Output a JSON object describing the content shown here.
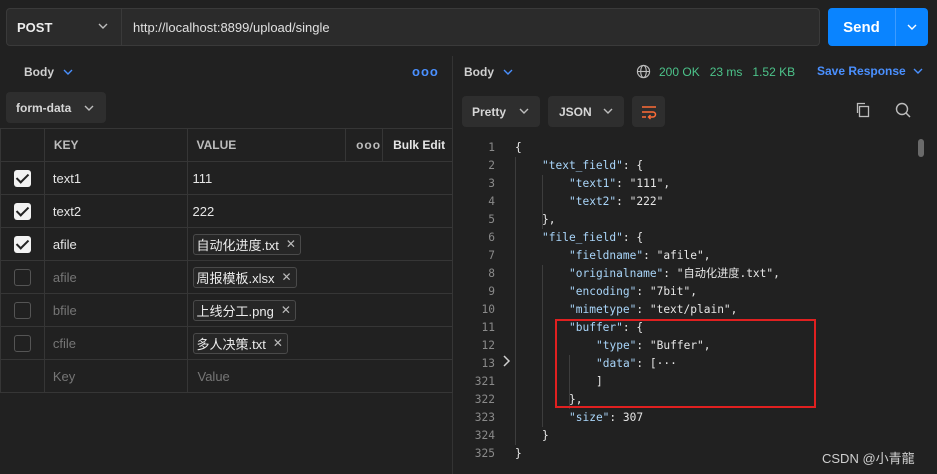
{
  "request": {
    "method": "POST",
    "url": "http://localhost:8899/upload/single",
    "send_label": "Send"
  },
  "left": {
    "body_tab": "Body",
    "more": "ooo",
    "body_type": "form-data",
    "table": {
      "headers": {
        "key": "KEY",
        "value": "VALUE",
        "more": "ooo",
        "bulk": "Bulk Edit"
      },
      "rows": [
        {
          "checked": true,
          "key": "text1",
          "value": "111",
          "type": "text"
        },
        {
          "checked": true,
          "key": "text2",
          "value": "222",
          "type": "text"
        },
        {
          "checked": true,
          "key": "afile",
          "value": "自动化进度.txt",
          "type": "file"
        },
        {
          "checked": false,
          "key": "afile",
          "value": "周报模板.xlsx",
          "type": "file"
        },
        {
          "checked": false,
          "key": "bfile",
          "value": "上线分工.png",
          "type": "file"
        },
        {
          "checked": false,
          "key": "cfile",
          "value": "多人决策.txt",
          "type": "file"
        }
      ],
      "placeholder_key": "Key",
      "placeholder_value": "Value"
    }
  },
  "response": {
    "body_tab": "Body",
    "status": "200 OK",
    "time": "23 ms",
    "size": "1.52 KB",
    "save_label": "Save Response",
    "format": "Pretty",
    "language": "JSON",
    "lines": [
      {
        "n": "1",
        "t": "{"
      },
      {
        "n": "2",
        "t": "\"text_field\": {"
      },
      {
        "n": "3",
        "t": "\"text1\": \"111\","
      },
      {
        "n": "4",
        "t": "\"text2\": \"222\""
      },
      {
        "n": "5",
        "t": "},"
      },
      {
        "n": "6",
        "t": "\"file_field\": {"
      },
      {
        "n": "7",
        "t": "\"fieldname\": \"afile\","
      },
      {
        "n": "8",
        "t": "\"originalname\": \"自动化进度.txt\","
      },
      {
        "n": "9",
        "t": "\"encoding\": \"7bit\","
      },
      {
        "n": "10",
        "t": "\"mimetype\": \"text/plain\","
      },
      {
        "n": "11",
        "t": "\"buffer\": {"
      },
      {
        "n": "12",
        "t": "\"type\": \"Buffer\","
      },
      {
        "n": "13",
        "t": "\"data\": [···"
      },
      {
        "n": "321",
        "t": "]"
      },
      {
        "n": "322",
        "t": "},"
      },
      {
        "n": "323",
        "t": "\"size\": 307"
      },
      {
        "n": "324",
        "t": "}"
      },
      {
        "n": "325",
        "t": "}"
      }
    ]
  },
  "watermark": "CSDN @小青龍"
}
